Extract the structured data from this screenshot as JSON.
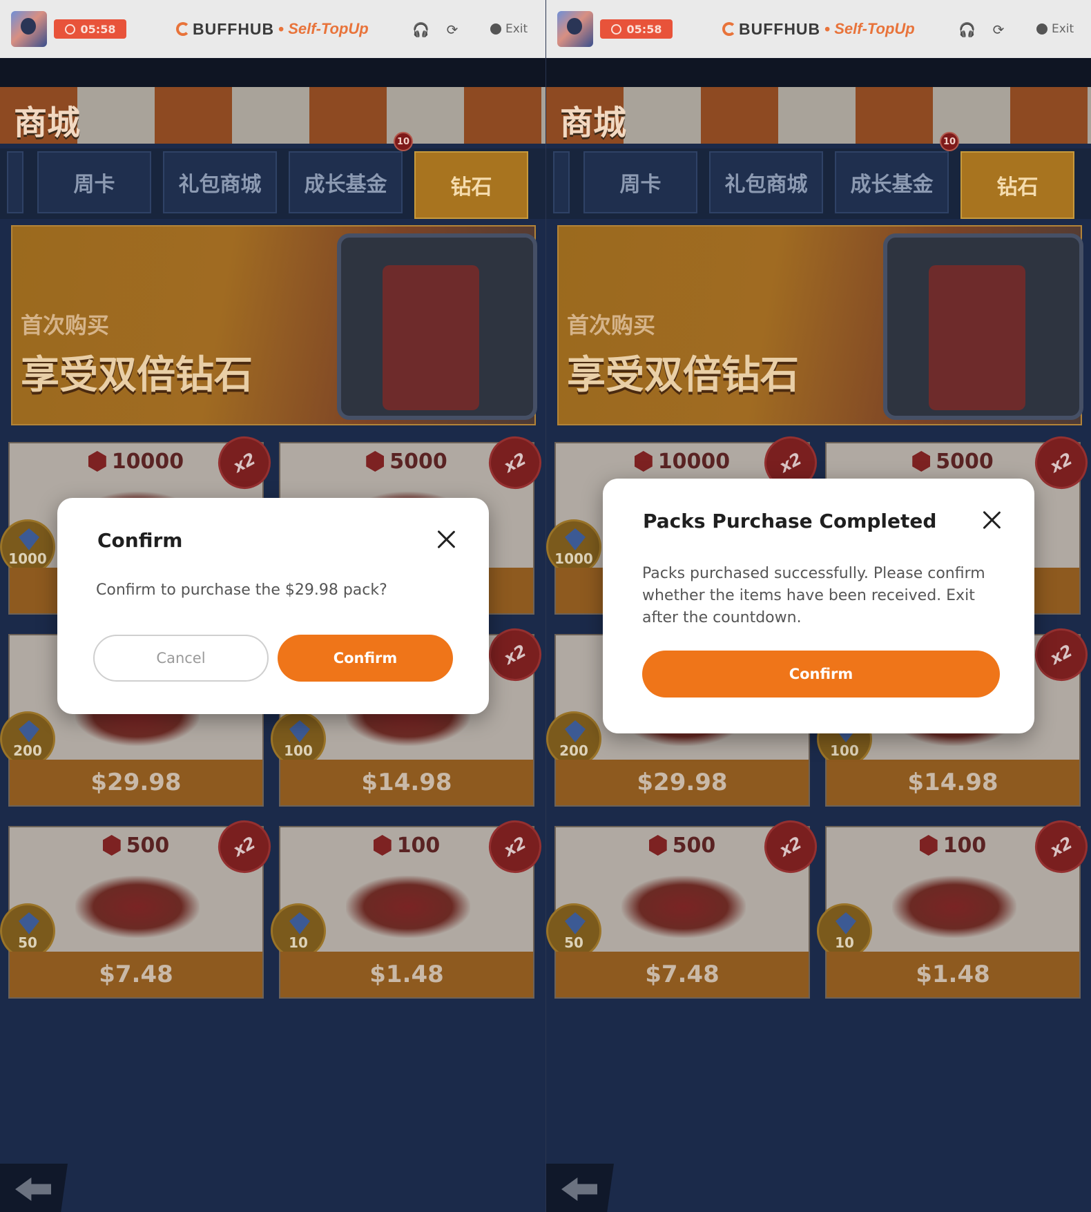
{
  "header": {
    "timer": "05:58",
    "brand_name": "BUFFHUB",
    "brand_separator": "•",
    "brand_sub": "Self-TopUp",
    "exit_label": "Exit",
    "icons": [
      "headset-icon",
      "refresh-icon",
      "power-icon"
    ]
  },
  "shop": {
    "title": "商城",
    "tabs": [
      "周卡",
      "礼包商城",
      "成长基金",
      "钻石"
    ],
    "active_tab": "钻石",
    "tab_badge": "10",
    "banner_small": "首次购买",
    "banner_big": "享受双倍钻石",
    "multiplier": "x2",
    "packs": [
      {
        "amount": "10000",
        "bonus": "1000",
        "price": ""
      },
      {
        "amount": "5000",
        "bonus": "",
        "price": ""
      },
      {
        "amount": "",
        "bonus": "200",
        "price": "$29.98"
      },
      {
        "amount": "",
        "bonus": "100",
        "price": "$14.98"
      },
      {
        "amount": "500",
        "bonus": "50",
        "price": "$7.48"
      },
      {
        "amount": "100",
        "bonus": "10",
        "price": "$1.48"
      }
    ]
  },
  "confirm_dialog": {
    "title": "Confirm",
    "message": "Confirm to purchase the $29.98 pack?",
    "cancel_label": "Cancel",
    "confirm_label": "Confirm"
  },
  "success_dialog": {
    "title": "Packs Purchase Completed",
    "message": "Packs purchased successfully. Please confirm whether the items have been received. Exit after the countdown.",
    "confirm_label": "Confirm"
  },
  "colors": {
    "accent": "#ef7519",
    "timer_bg": "#e8533a",
    "page_bg": "#1b2a4a"
  }
}
